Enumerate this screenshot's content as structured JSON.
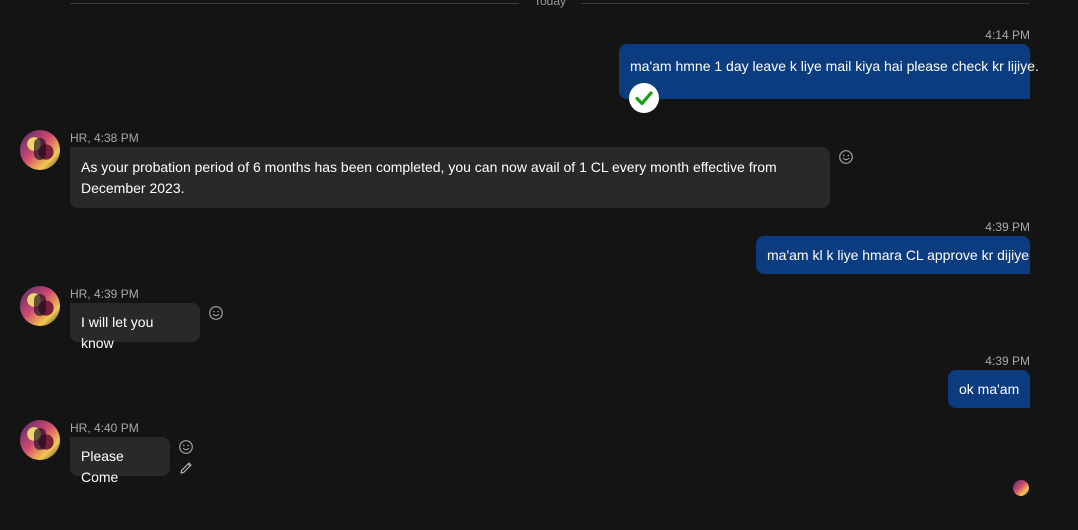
{
  "divider": {
    "label": "Today"
  },
  "messages": {
    "m1": {
      "time": "4:14 PM",
      "text": "ma'am hmne 1 day leave k liye mail kiya hai please check kr lijiye."
    },
    "m2": {
      "meta": "HR, 4:38 PM",
      "text": "As your probation period of 6 months has been completed, you can now avail of 1 CL every month effective from December 2023."
    },
    "m3": {
      "time": "4:39 PM",
      "text": "ma'am kl k liye hmara CL approve kr dijiye"
    },
    "m4": {
      "meta": "HR, 4:39 PM",
      "text": "I will let you know"
    },
    "m5": {
      "time": "4:39 PM",
      "text": "ok ma'am"
    },
    "m6": {
      "meta": "HR, 4:40 PM",
      "text": "Please Come"
    }
  },
  "icons": {
    "reaction": "smiley-icon",
    "edit": "pencil-icon",
    "seen": "check-circle-icon",
    "read_receipt": "avatar-read-receipt"
  },
  "colors": {
    "background": "#141414",
    "outgoing_bubble": "#0c3c80",
    "incoming_bubble": "#292929",
    "check_green": "#13a10e"
  }
}
